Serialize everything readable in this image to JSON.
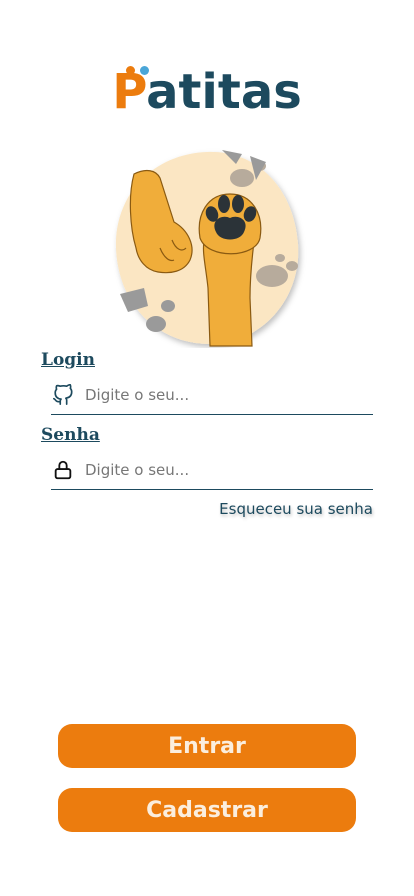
{
  "brand": {
    "logo_first_letter": "P",
    "logo_rest": "atitas"
  },
  "login": {
    "label": "Login",
    "placeholder": "Digite o seu..."
  },
  "password": {
    "label": "Senha",
    "placeholder": "Digite o seu..."
  },
  "forgot_password": "Esqueceu sua senha",
  "buttons": {
    "enter": "Entrar",
    "register": "Cadastrar"
  },
  "colors": {
    "primary": "#ec7c0e",
    "dark": "#1d4a5e",
    "accent": "#4aa6d8",
    "paw": "#f0ad3a"
  },
  "icons": {
    "login": "github-icon",
    "password": "lock-icon"
  }
}
